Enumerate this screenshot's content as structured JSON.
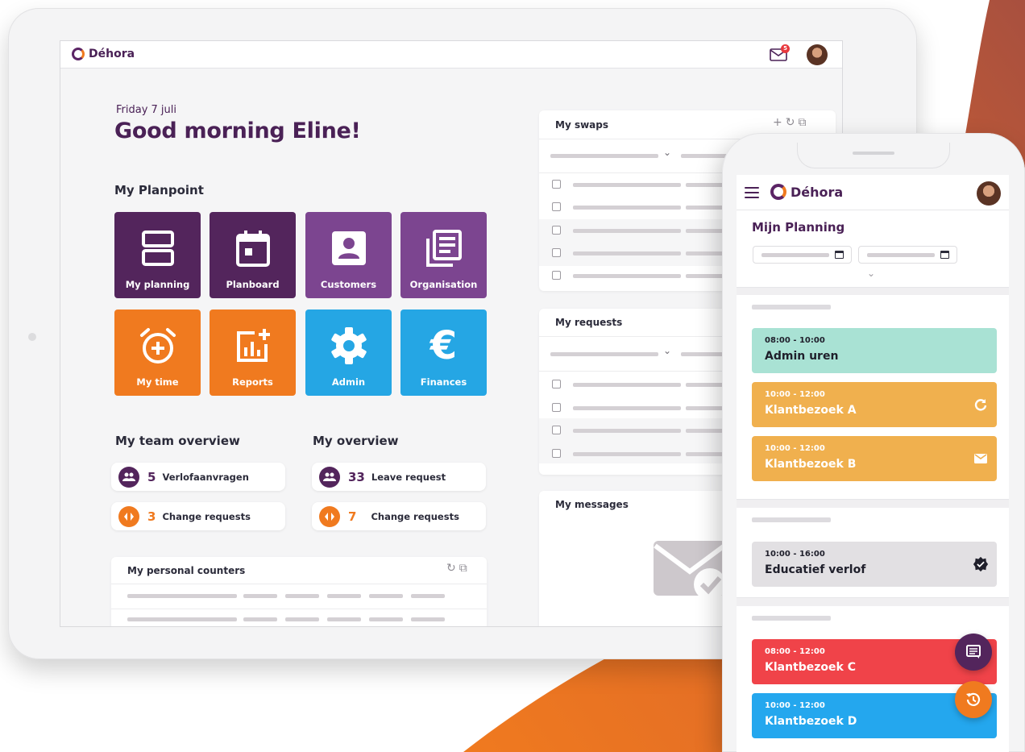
{
  "brand": {
    "name": "Déhora"
  },
  "colors": {
    "primary_purple": "#53255c",
    "secondary_purple": "#7c4590",
    "orange": "#f07a1f",
    "blue": "#25a6e4",
    "event_mint": "#a9e2d4",
    "event_yellow": "#f0b04e",
    "event_red": "#f04349",
    "event_blue": "#24a7ee"
  },
  "tablet": {
    "header": {
      "notification_count": "5",
      "icons": [
        "mail-icon",
        "avatar"
      ]
    },
    "date": "Friday 7 juli",
    "greeting": "Good morning Eline!",
    "planpoint": {
      "heading": "My Planpoint",
      "tiles": [
        {
          "label": "My planning",
          "icon": "planning-icon"
        },
        {
          "label": "Planboard",
          "icon": "calendar-icon"
        },
        {
          "label": "Customers",
          "icon": "contact-card-icon"
        },
        {
          "label": "Organisation",
          "icon": "documents-icon"
        },
        {
          "label": "My time",
          "icon": "alarm-clock-icon"
        },
        {
          "label": "Reports",
          "icon": "chart-add-icon"
        },
        {
          "label": "Admin",
          "icon": "gear-icon"
        },
        {
          "label": "Finances",
          "icon": "euro-icon"
        }
      ]
    },
    "team_overview": {
      "heading": "My team overview",
      "items": [
        {
          "count": "5",
          "label": "Verlofaanvragen",
          "icon": "people-icon"
        },
        {
          "count": "3",
          "label": "Change requests",
          "icon": "swap-icon"
        }
      ]
    },
    "my_overview": {
      "heading": "My overview",
      "items": [
        {
          "count": "33",
          "label": "Leave request",
          "icon": "people-icon"
        },
        {
          "count": "7",
          "label": "Change requests",
          "icon": "swap-icon"
        }
      ]
    },
    "personal_counters": {
      "title": "My personal counters",
      "actions": [
        "refresh-icon",
        "external-link-icon"
      ]
    },
    "swaps": {
      "title": "My swaps",
      "actions": [
        "add-icon",
        "refresh-icon",
        "external-link-icon"
      ]
    },
    "requests": {
      "title": "My requests"
    },
    "messages": {
      "title": "My messages"
    }
  },
  "phone": {
    "title": "Mijn Planning",
    "events": [
      {
        "time": "08:00 - 10:00",
        "name": "Admin uren",
        "color": "mint",
        "icon": ""
      },
      {
        "time": "10:00 - 12:00",
        "name": "Klantbezoek A",
        "color": "yellow",
        "icon": "refresh-icon"
      },
      {
        "time": "10:00 - 12:00",
        "name": "Klantbezoek B",
        "color": "yellow",
        "icon": "mail-icon"
      },
      {
        "time": "10:00 - 16:00",
        "name": "Educatief verlof",
        "color": "grey",
        "icon": "verified-badge-icon"
      },
      {
        "time": "08:00 - 12:00",
        "name": "Klantbezoek C",
        "color": "red",
        "icon": ""
      },
      {
        "time": "10:00 - 12:00",
        "name": "Klantbezoek D",
        "color": "blue",
        "icon": ""
      }
    ],
    "fabs": [
      "chat-icon",
      "history-icon"
    ]
  }
}
